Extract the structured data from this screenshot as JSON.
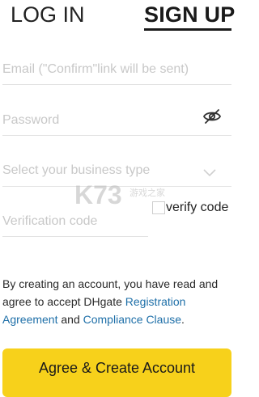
{
  "tabs": {
    "login_label": "LOG IN",
    "signup_label": "SIGN UP",
    "active": "signup"
  },
  "form": {
    "email_placeholder": "Email (\"Confirm\"link will be sent)",
    "email_value": "",
    "password_placeholder": "Password",
    "password_value": "",
    "password_toggle_icon": "eye-slash-icon",
    "business_type_placeholder": "Select your business type",
    "business_type_icon": "chevron-down-icon",
    "verification_placeholder": "Verification code",
    "verification_value": "",
    "verify_code_label": "verify code"
  },
  "agreement": {
    "prefix": "By creating an account, you have read and agree to accept DHgate ",
    "registration_link": "Registration Agreement",
    "middle": " and ",
    "compliance_link": "Compliance Clause",
    "suffix": "."
  },
  "submit": {
    "label": "Agree & Create Account"
  },
  "watermark": {
    "text": "K73",
    "subtext": "游戏之家"
  },
  "colors": {
    "accent_yellow": "#f7d11b",
    "link_blue": "#1e6fa8",
    "placeholder_gray": "#c8c8c8",
    "divider": "#e3e3e3",
    "text_dark": "#222222"
  }
}
